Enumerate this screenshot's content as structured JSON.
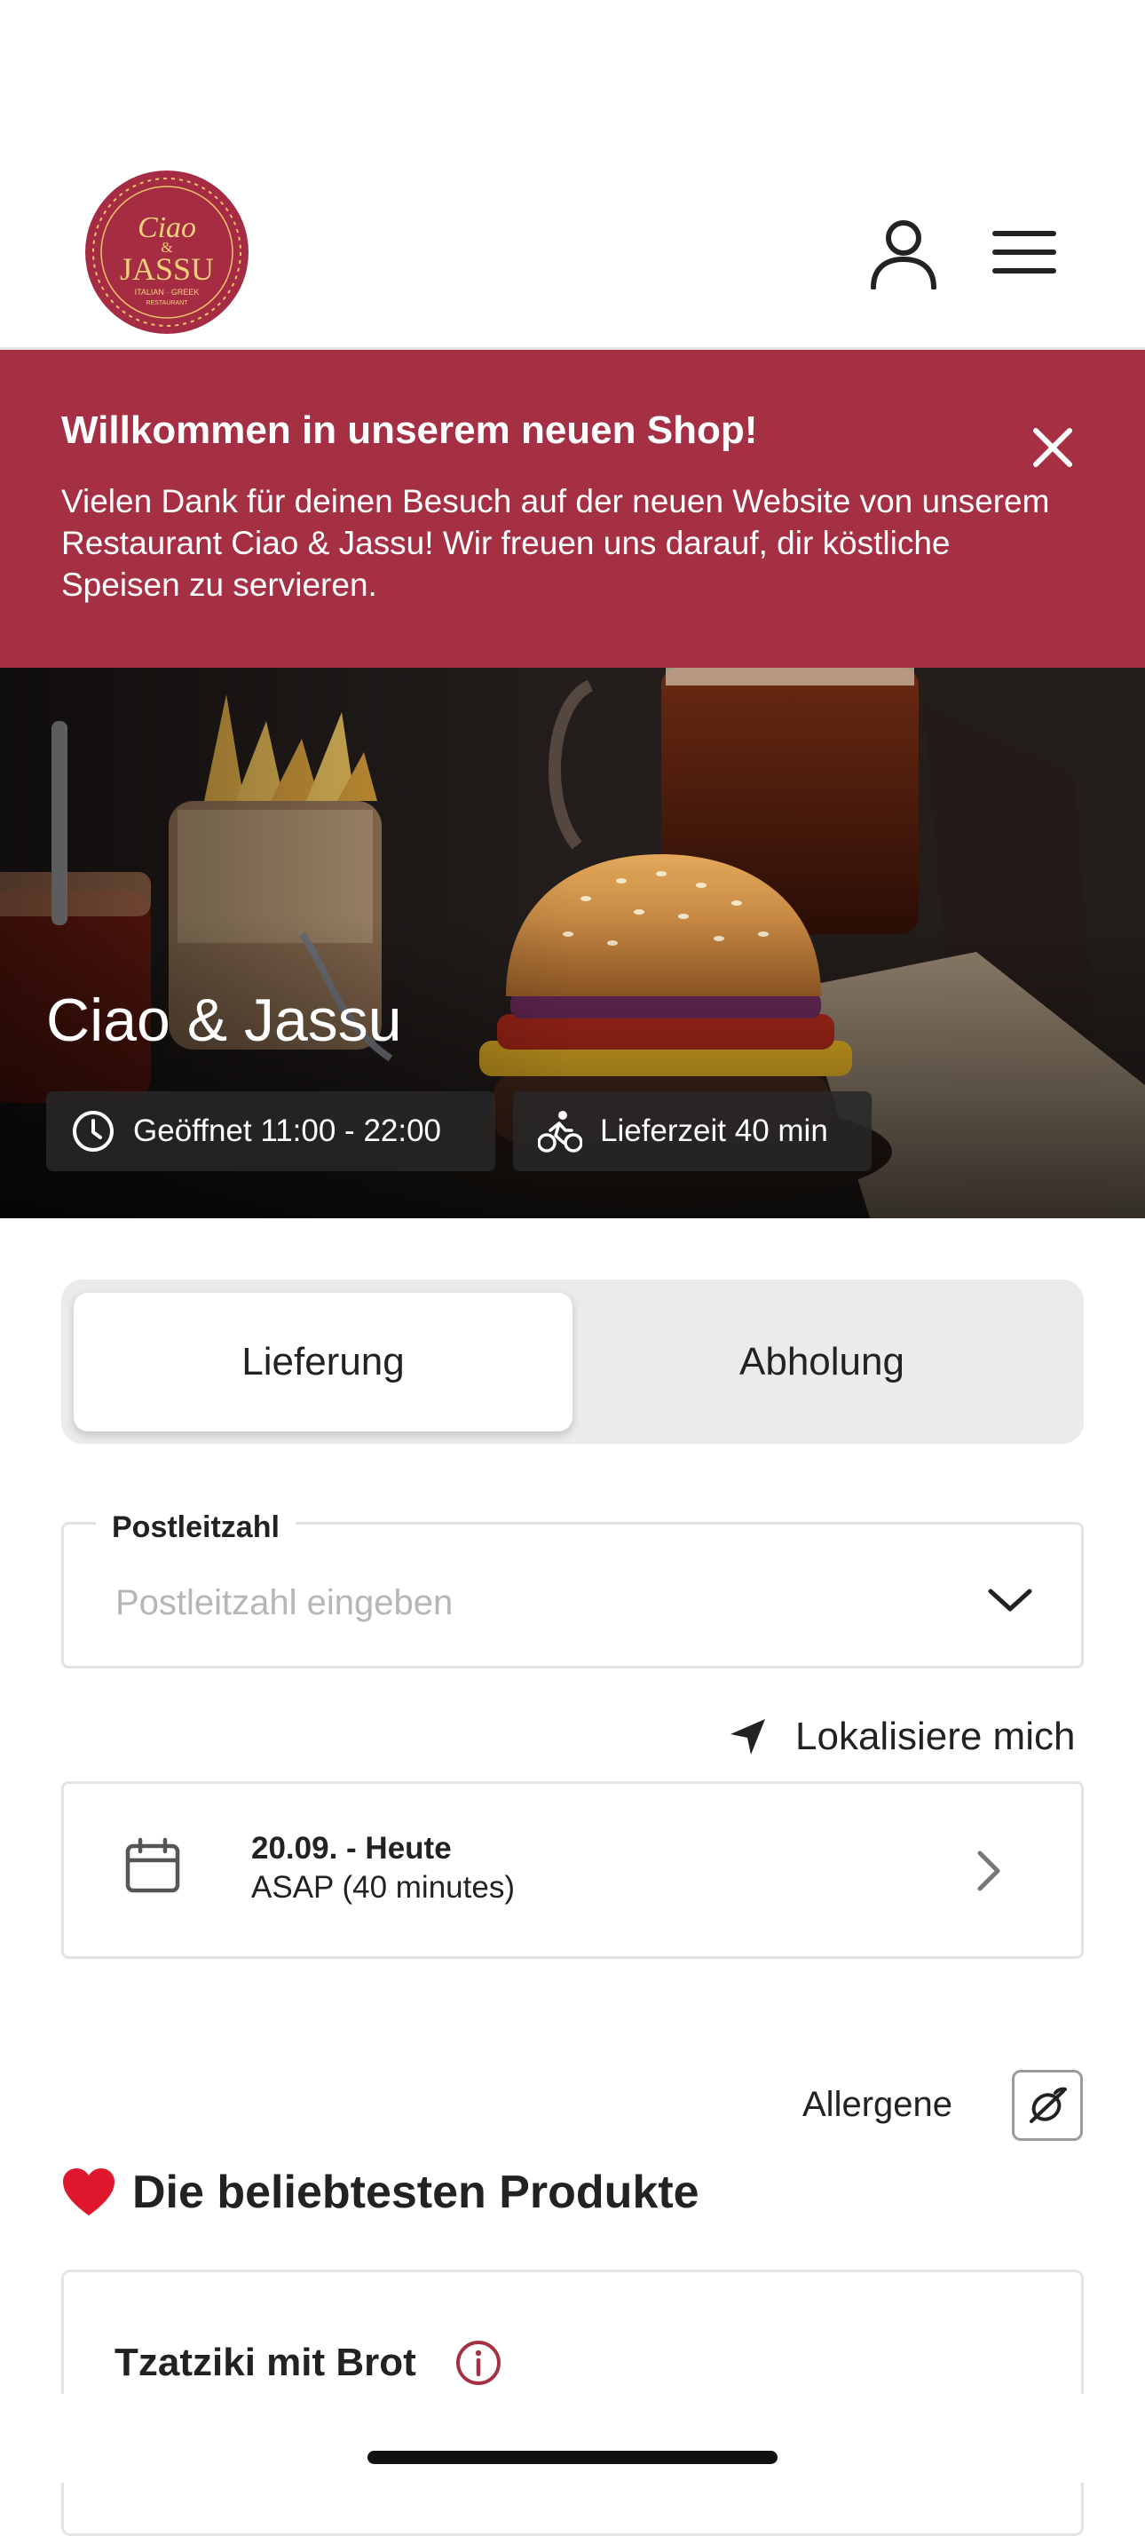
{
  "header": {
    "logo": {
      "line1": "Ciao",
      "amp": "&",
      "line2": "JASSU",
      "tagline": "ITALIAN · GREEK",
      "tagline2": "RESTAURANT",
      "color": "#a62c43"
    },
    "icons": [
      "user-icon",
      "hamburger-menu-icon"
    ]
  },
  "banner": {
    "title": "Willkommen in unserem neuen Shop!",
    "text": "Vielen Dank für deinen Besuch auf der neuen Website von unserem Restaurant Ciao & Jassu! Wir freuen uns darauf, dir köstliche Speisen zu servieren.",
    "background": "#a53044",
    "icon": "close-icon"
  },
  "hero": {
    "title": "Ciao & Jassu",
    "opening": "Geöffnet 11:00 - 22:00",
    "delivery_time": "Lieferzeit 40 min",
    "icons": [
      "clock-icon",
      "bicycle-courier-icon"
    ]
  },
  "order_type": {
    "options": [
      "Lieferung",
      "Abholung"
    ],
    "selected": "Lieferung"
  },
  "postcode": {
    "label": "Postleitzahl",
    "placeholder": "Postleitzahl eingeben",
    "value": ""
  },
  "locate": {
    "label": "Lokalisiere mich",
    "icon": "location-arrow-icon"
  },
  "schedule": {
    "date": "20.09. - Heute",
    "time": "ASAP (40 minutes)",
    "icon": "calendar-icon"
  },
  "allergens": {
    "label": "Allergene",
    "icon": "allergen-filter-icon"
  },
  "popular": {
    "heading": "Die beliebtesten Produkte",
    "heading_icon": "heart-icon",
    "products": [
      {
        "name": "Tzatziki mit Brot",
        "icon": "info-icon"
      }
    ]
  },
  "colors": {
    "brand": "#a53044",
    "text": "#222222",
    "placeholder": "#b6b6b6"
  }
}
